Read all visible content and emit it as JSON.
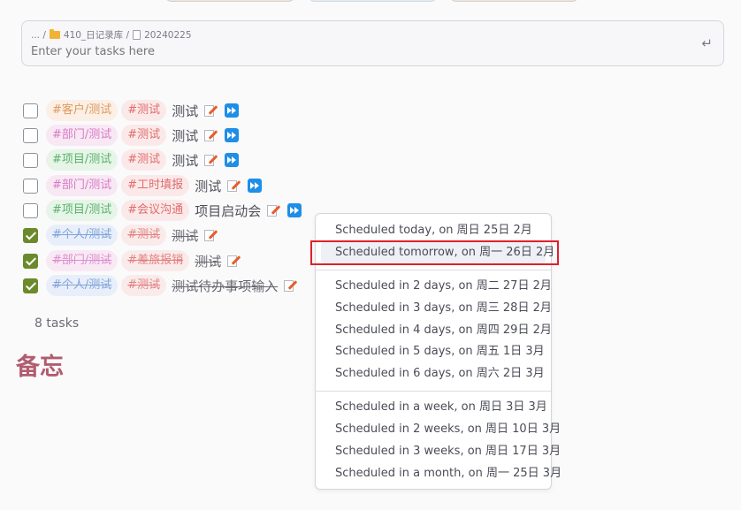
{
  "input": {
    "breadcrumb_ellipsis": "... /",
    "breadcrumb_folder": "410_日记录库 /",
    "breadcrumb_file": "20240225",
    "placeholder": "Enter your tasks here",
    "enter_glyph": "↵"
  },
  "tasks": [
    {
      "tags": [
        {
          "text": "#客户/测试",
          "color": "orange"
        },
        {
          "text": "#测试",
          "color": "red"
        }
      ],
      "text": "测试",
      "done": false
    },
    {
      "tags": [
        {
          "text": "#部门/测试",
          "color": "pink"
        },
        {
          "text": "#测试",
          "color": "red"
        }
      ],
      "text": "测试",
      "done": false
    },
    {
      "tags": [
        {
          "text": "#项目/测试",
          "color": "green"
        },
        {
          "text": "#测试",
          "color": "red"
        }
      ],
      "text": "测试",
      "done": false
    },
    {
      "tags": [
        {
          "text": "#部门/测试",
          "color": "pink"
        },
        {
          "text": "#工时填报",
          "color": "red"
        }
      ],
      "text": "测试",
      "done": false
    },
    {
      "tags": [
        {
          "text": "#项目/测试",
          "color": "green"
        },
        {
          "text": "#会议沟通",
          "color": "red"
        }
      ],
      "text": "项目启动会",
      "done": false
    },
    {
      "tags": [
        {
          "text": "#个人/测试",
          "color": "blue"
        },
        {
          "text": "#测试",
          "color": "red"
        }
      ],
      "text": "测试",
      "done": true
    },
    {
      "tags": [
        {
          "text": "#部门/测试",
          "color": "pink"
        },
        {
          "text": "#差旅报销",
          "color": "red"
        }
      ],
      "text": "测试",
      "done": true
    },
    {
      "tags": [
        {
          "text": "#个人/测试",
          "color": "blue"
        },
        {
          "text": "#测试",
          "color": "red"
        }
      ],
      "text": "测试待办事项输入",
      "done": true
    }
  ],
  "task_count": "8 tasks",
  "memo_heading": "备忘",
  "menu": {
    "items": [
      "Scheduled today, on 周日 25日 2月",
      "Scheduled tomorrow, on 周一 26日 2月",
      "Scheduled in 2 days, on 周二 27日 2月",
      "Scheduled in 3 days, on 周三 28日 2月",
      "Scheduled in 4 days, on 周四 29日 2月",
      "Scheduled in 5 days, on 周五 1日 3月",
      "Scheduled in 6 days, on 周六 2日 3月",
      "Scheduled in a week, on 周日 3日 3月",
      "Scheduled in 2 weeks, on 周日 10日 3月",
      "Scheduled in 3 weeks, on 周日 17日 3月",
      "Scheduled in a month, on 周一 25日 3月"
    ],
    "highlighted_index": 1
  },
  "colors": {
    "accent_checkbox": "#6b8a2b",
    "highlight_box": "#e0202a",
    "memo_heading": "#b15c6f"
  }
}
